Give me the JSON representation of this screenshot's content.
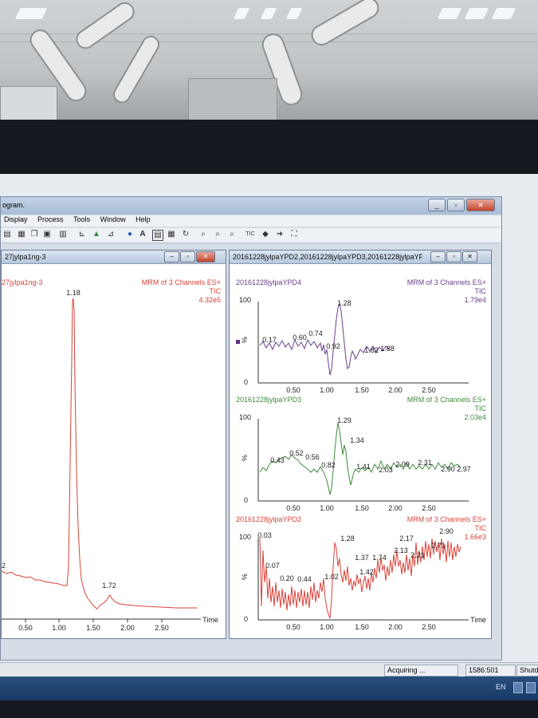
{
  "app": {
    "title": "ogram.",
    "menu": [
      "Display",
      "Process",
      "Tools",
      "Window",
      "Help"
    ],
    "toolbar_icons": [
      "open-icon",
      "print-icon",
      "copy-icon",
      "paste-icon",
      "chart-icon",
      "peak-icon",
      "integrate-icon",
      "globe-icon",
      "text-icon",
      "layout-icon",
      "refresh-icon",
      "zoom-in-icon",
      "zoom-out-icon",
      "zoom-reset-icon",
      "tic-icon",
      "back-icon",
      "forward-icon",
      "fit-icon"
    ],
    "toolbar_tic_label": "TIC"
  },
  "left_window": {
    "title": "27jylpa1ng-3",
    "sample": "27jylpa1ng-3",
    "header": "MRM of 3 Channels ES+",
    "mode": "TIC",
    "intensity": "4.32e5",
    "peak_labels": [
      "1.18",
      "1.72",
      "2"
    ],
    "x_ticks": [
      "0.50",
      "1.00",
      "1.50",
      "2.00",
      "2.50"
    ],
    "x_axis_label": "Time",
    "trace_color": "#d9423a"
  },
  "right_window": {
    "title": "20161228jylpaYPD2,20161228jylpaYPD3,20161228jylpaYP...",
    "panels": [
      {
        "sample": "20161228jylpaYPD4",
        "header": "MRM of 3 Channels ES+",
        "mode": "TIC",
        "intensity": "1.79e4",
        "y_max": "100",
        "y_min": "0",
        "y_unit": "%",
        "peak_labels": [
          "1.28",
          "0.17",
          "0.60",
          "0.74",
          "0.92",
          "1.82",
          "1.88"
        ],
        "x_ticks": [
          "0.50",
          "1.00",
          "1.50",
          "2.00",
          "2.50"
        ],
        "color": "#6a3d8f",
        "header_color": "#6a3d8f"
      },
      {
        "sample": "20161228jylpaYPD3",
        "header": "MRM of 3 Channels ES+",
        "mode": "TIC",
        "intensity": "2.03e4",
        "y_max": "100",
        "y_min": "0",
        "y_unit": "%",
        "peak_labels": [
          "1.29",
          "1.34",
          "0.52",
          "0.56",
          "0.43",
          "0.82",
          "1.41",
          "2.03",
          "2.09",
          "2.31",
          "2.90",
          "2.97"
        ],
        "x_ticks": [
          "0.50",
          "1.00",
          "1.50",
          "2.00",
          "2.50"
        ],
        "color": "#3f8a3c",
        "header_color": "#3f8a3c"
      },
      {
        "sample": "20161228jylpaYPD2",
        "header": "MRM of 3 Channels ES+",
        "mode": "TIC",
        "intensity": "1.66e3",
        "y_max": "100",
        "y_min": "0",
        "y_unit": "%",
        "peak_labels": [
          "0.03",
          "2.90",
          "1.28",
          "2.17",
          "2.71",
          "2.13",
          "2.21",
          "1.37",
          "1.74",
          "0.07",
          "1.42",
          "0.20",
          "0.44",
          "1.02"
        ],
        "x_ticks": [
          "0.50",
          "1.00",
          "1.50",
          "2.00",
          "2.50"
        ],
        "x_axis_label": "Time",
        "color": "#d9423a",
        "header_color": "#d9423a"
      }
    ]
  },
  "status": {
    "state": "Acquiring ...",
    "position": "1586:501",
    "shutdown": "Shutd"
  },
  "taskbar": {
    "language": "EN"
  }
}
